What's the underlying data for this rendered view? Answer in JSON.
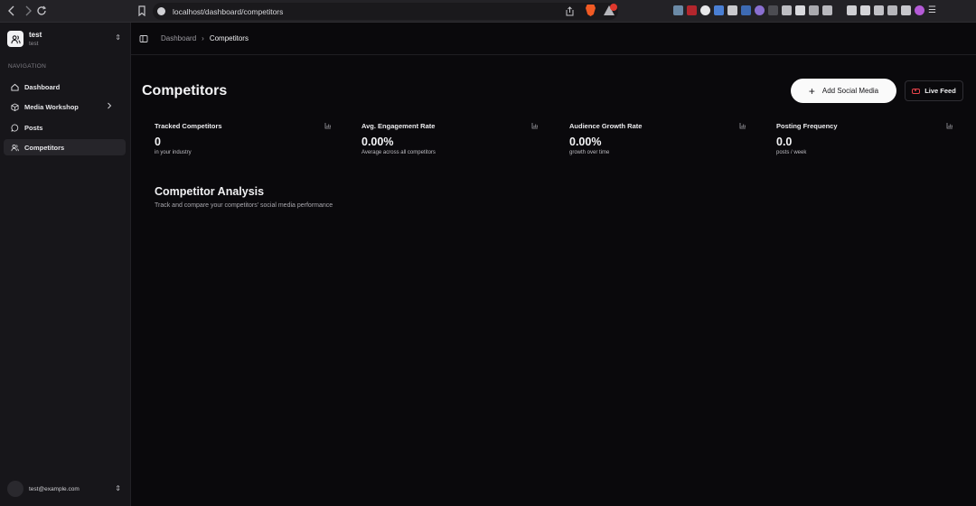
{
  "browser": {
    "url": "localhost/dashboard/competitors"
  },
  "workspace": {
    "name": "test",
    "subtitle": "test"
  },
  "sidebar": {
    "section_label": "NAVIGATION",
    "items": [
      {
        "label": "Dashboard",
        "icon": "home-icon"
      },
      {
        "label": "Media Workshop",
        "icon": "box-icon"
      },
      {
        "label": "Posts",
        "icon": "message-circle-icon"
      },
      {
        "label": "Competitors",
        "icon": "users-icon",
        "active": true
      }
    ]
  },
  "user": {
    "email": "test@example.com"
  },
  "breadcrumb": {
    "parent": "Dashboard",
    "current": "Competitors"
  },
  "page": {
    "title": "Competitors",
    "add_button": "Add Social Media",
    "live_button": "Live Feed"
  },
  "stats": [
    {
      "label": "Tracked Competitors",
      "value": "0",
      "sub": "in your industry"
    },
    {
      "label": "Avg. Engagement Rate",
      "value": "0.00%",
      "sub": "Average across all competitors"
    },
    {
      "label": "Audience Growth Rate",
      "value": "0.00%",
      "sub": "growth over time"
    },
    {
      "label": "Posting Frequency",
      "value": "0.0",
      "sub": "posts / week"
    }
  ],
  "analysis": {
    "title": "Competitor Analysis",
    "subtitle": "Track and compare your competitors' social media performance"
  },
  "colors": {
    "background": "#0a090c",
    "sidebar": "#17161a",
    "accent_live": "#e8434a"
  }
}
